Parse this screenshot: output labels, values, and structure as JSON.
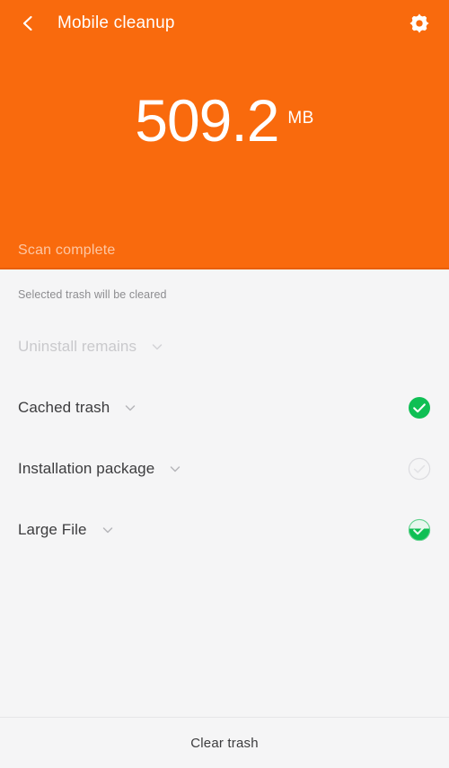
{
  "header": {
    "back_icon": "chevron-left-icon",
    "title": "Mobile cleanup",
    "settings_icon": "gear-icon",
    "size_value": "509.2",
    "size_unit": "MB",
    "status": "Scan complete",
    "background_color": "#f96a0d"
  },
  "body": {
    "hint": "Selected trash will be cleared",
    "rows": [
      {
        "label": "Uninstall remains",
        "expand_icon": "chevron-down-icon",
        "state": "disabled",
        "checkbox": "none"
      },
      {
        "label": "Cached trash",
        "expand_icon": "chevron-down-icon",
        "state": "enabled",
        "checkbox": "checked"
      },
      {
        "label": "Installation package",
        "expand_icon": "chevron-down-icon",
        "state": "enabled",
        "checkbox": "unchecked"
      },
      {
        "label": "Large File",
        "expand_icon": "chevron-down-icon",
        "state": "enabled",
        "checkbox": "partial"
      }
    ]
  },
  "footer": {
    "action_label": "Clear trash"
  },
  "colors": {
    "accent_orange": "#f96a0d",
    "check_green": "#0fbf54",
    "unchecked_grey": "#d9d9dc",
    "body_background": "#f5f5f6"
  }
}
